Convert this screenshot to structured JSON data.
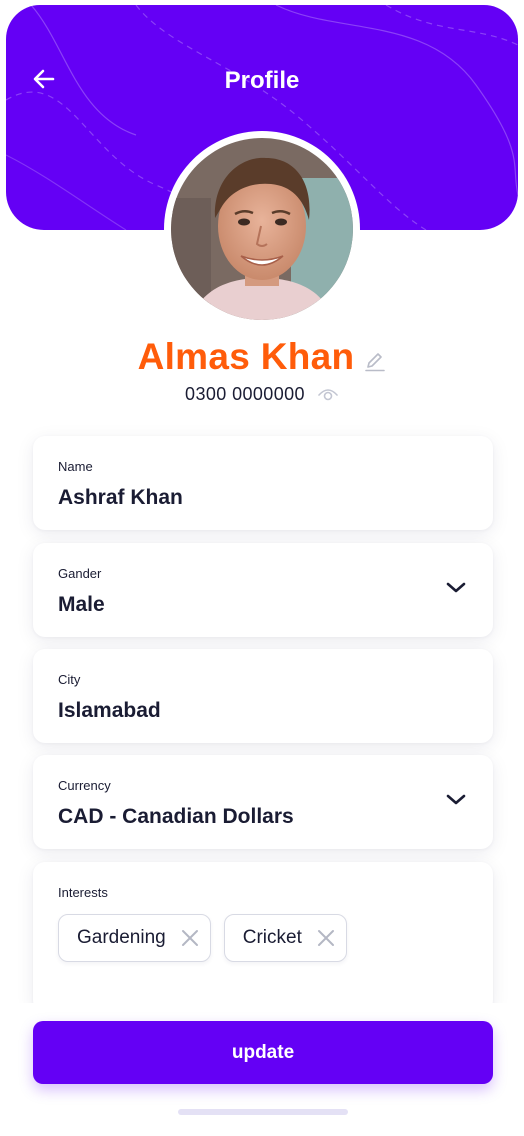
{
  "header": {
    "title": "Profile"
  },
  "profile": {
    "display_name": "Almas Khan",
    "phone": "0300 0000000"
  },
  "form": {
    "name": {
      "label": "Name",
      "value": "Ashraf Khan"
    },
    "gender": {
      "label": "Gander",
      "value": "Male"
    },
    "city": {
      "label": "City",
      "value": "Islamabad"
    },
    "currency": {
      "label": "Currency",
      "value": "CAD - Canadian Dollars"
    },
    "interests": {
      "label": "Interests",
      "items": [
        {
          "label": "Gardening"
        },
        {
          "label": "Cricket"
        }
      ]
    }
  },
  "actions": {
    "update_label": "update"
  },
  "icons": {
    "back": "arrow-left-icon",
    "edit": "pencil-icon",
    "visibility": "eye-icon",
    "dropdown": "chevron-down-icon",
    "remove": "close-icon"
  },
  "colors": {
    "brand": "#6400f5",
    "accent": "#ff5c0a",
    "text": "#1a1c33"
  }
}
